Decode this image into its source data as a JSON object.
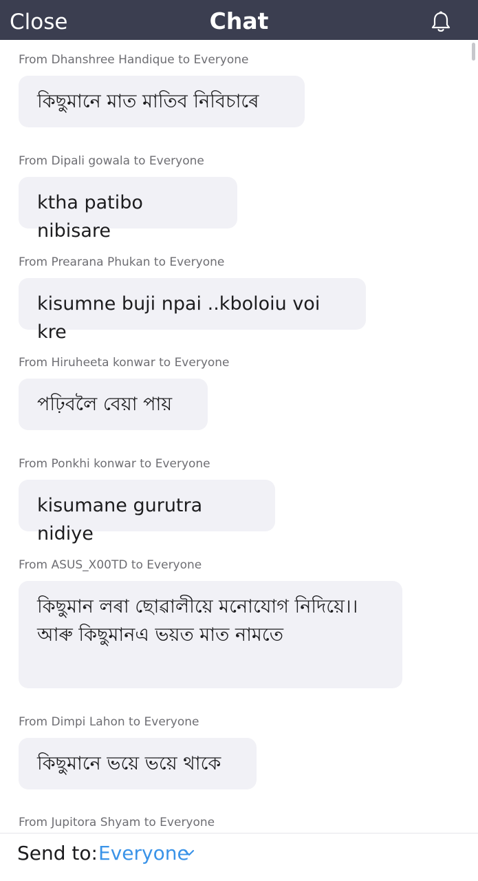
{
  "header": {
    "close_label": "Close",
    "title": "Chat"
  },
  "messages": [
    {
      "sender": "From Dhanshree Handique to Everyone",
      "text": "কিছুমানে মাত মাতিব নিবিচাৰে"
    },
    {
      "sender": "From Dipali gowala to Everyone",
      "text": "ktha patibo nibisare"
    },
    {
      "sender": "From Prearana Phukan to Everyone",
      "text": "kisumne buji npai ..kboloiu voi kre"
    },
    {
      "sender": "From Hiruheeta konwar to Everyone",
      "text": "পঢ়িবলৈ বেয়া পায়"
    },
    {
      "sender": "From Ponkhi konwar to Everyone",
      "text": "kisumane gurutra nidiye"
    },
    {
      "sender": "From ASUS_X00TD to Everyone",
      "text": "কিছুমান লৰা ছোৱালীয়ে মনোযোগ নিদিয়ে।। আৰু কিছুমানএ ভয়ত মাত নামতে"
    },
    {
      "sender": "From Dimpi Lahon to Everyone",
      "text": "কিছুমানে ভয়ে ভয়ে থাকে"
    },
    {
      "sender": "From Jupitora Shyam to Everyone",
      "text": ""
    }
  ],
  "footer": {
    "send_to_label": "Send to:",
    "send_to_value": "Everyone"
  },
  "colors": {
    "header_bg": "#3b3e50",
    "bubble_bg": "#f1f1f6",
    "accent": "#3a93e8"
  },
  "icons": {
    "notification": "bell-icon",
    "dropdown": "chevron-down-icon"
  }
}
